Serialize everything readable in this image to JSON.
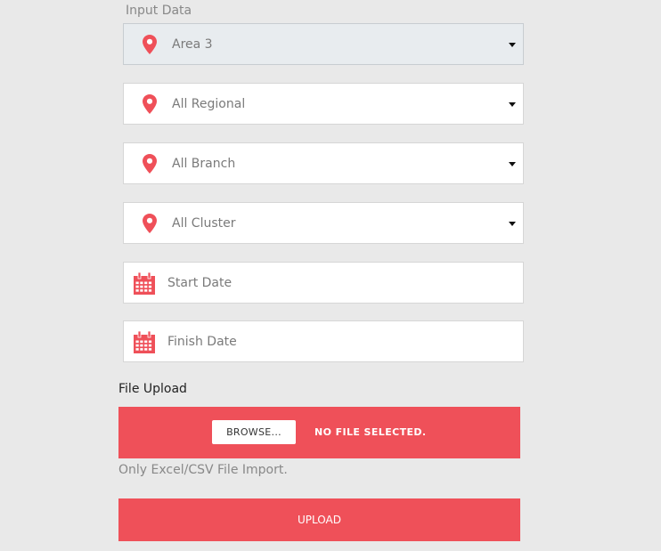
{
  "form": {
    "section_title": "Input Data",
    "accent_color": "#ef5059",
    "selects": [
      {
        "value": "Area 3",
        "icon": "map-pin-icon"
      },
      {
        "value": "All Regional",
        "icon": "map-pin-icon"
      },
      {
        "value": "All Branch",
        "icon": "map-pin-icon"
      },
      {
        "value": "All Cluster",
        "icon": "map-pin-icon"
      }
    ],
    "dates": [
      {
        "placeholder": "Start Date",
        "icon": "calendar-icon"
      },
      {
        "placeholder": "Finish Date",
        "icon": "calendar-icon"
      }
    ]
  },
  "file_upload": {
    "title": "File Upload",
    "browse_label": "BROWSE...",
    "status": "NO FILE SELECTED.",
    "hint": "Only Excel/CSV File Import.",
    "submit_label": "UPLOAD"
  }
}
